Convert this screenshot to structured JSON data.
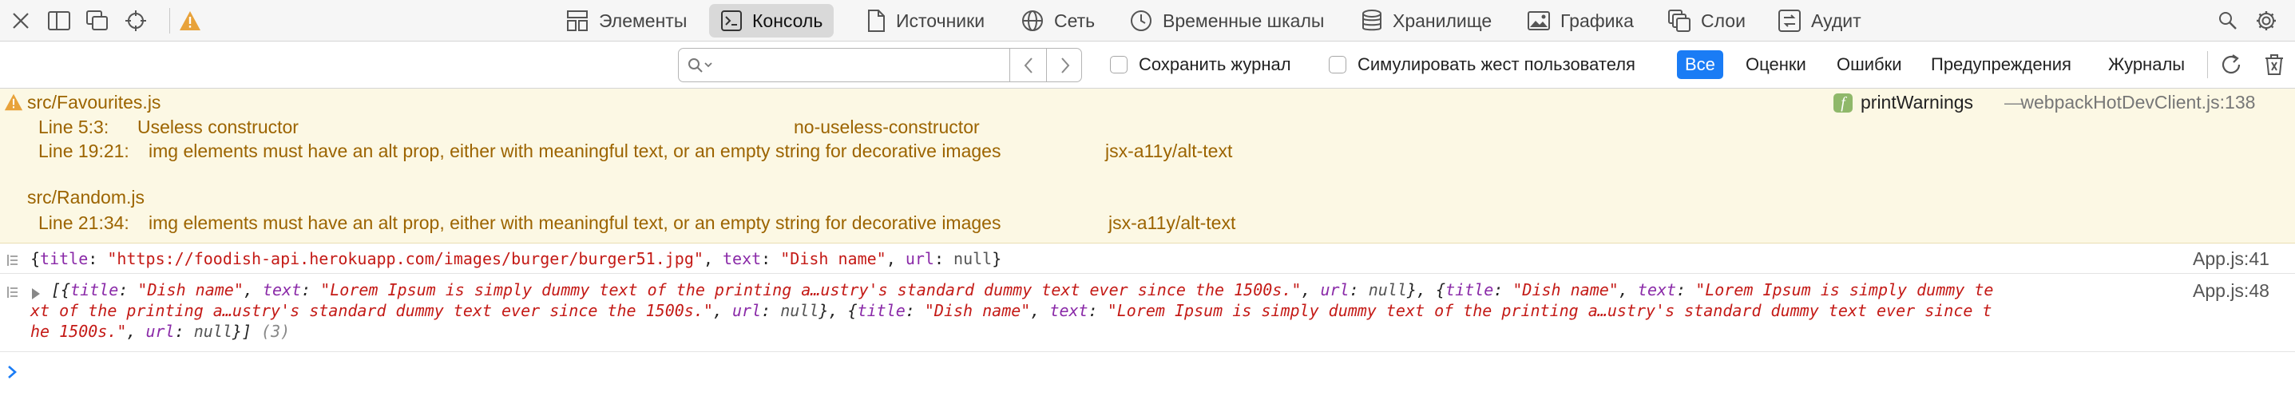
{
  "colors": {
    "accent": "#1a7cf5",
    "warning_text": "#9c6400",
    "warning_bg": "#fcf8e4",
    "key": "#8a2aa8",
    "string": "#c41a16"
  },
  "toolbar": {
    "left_icons": [
      "close-icon",
      "dock-side-icon",
      "undock-icon",
      "inspect-target-icon",
      "warning-icon"
    ],
    "tabs": [
      {
        "id": "elements",
        "label": "Элементы",
        "icon": "elements-icon"
      },
      {
        "id": "console",
        "label": "Консоль",
        "icon": "console-icon",
        "active": true
      },
      {
        "id": "sources",
        "label": "Источники",
        "icon": "document-icon"
      },
      {
        "id": "network",
        "label": "Сеть",
        "icon": "globe-icon"
      },
      {
        "id": "timelines",
        "label": "Временные шкалы",
        "icon": "clock-icon"
      },
      {
        "id": "storage",
        "label": "Хранилище",
        "icon": "database-icon"
      },
      {
        "id": "graphics",
        "label": "Графика",
        "icon": "image-icon"
      },
      {
        "id": "layers",
        "label": "Слои",
        "icon": "layers-icon"
      },
      {
        "id": "audit",
        "label": "Аудит",
        "icon": "audit-icon"
      }
    ],
    "right_icons": [
      "search-icon",
      "gear-icon"
    ]
  },
  "filter": {
    "search_value": "",
    "search_placeholder": "",
    "preserve_log_label": "Сохранить журнал",
    "simulate_gesture_label": "Симулировать жест пользователя",
    "levels": [
      {
        "label": "Все",
        "active": true
      },
      {
        "label": "Оценки"
      },
      {
        "label": "Ошибки"
      },
      {
        "label": "Предупреждения"
      },
      {
        "label": "Журналы"
      }
    ]
  },
  "console": {
    "warning": {
      "file1": "src/Favourites.js",
      "line1_loc": "Line 5:3:",
      "line1_msg": "Useless constructor",
      "line1_rule": "no-useless-constructor",
      "line2_loc": "Line 19:21:",
      "line2_msg": "img elements must have an alt prop, either with meaningful text, or an empty string for decorative images",
      "line2_rule": "jsx-a11y/alt-text",
      "file2": "src/Random.js",
      "line3_loc": "Line 21:34:",
      "line3_msg": "img elements must have an alt prop, either with meaningful text, or an empty string for decorative images",
      "line3_rule": "jsx-a11y/alt-text",
      "func": "printWarnings",
      "dash": "—",
      "source": "webpackHotDevClient.js:138"
    },
    "log1": {
      "source": "App.js:41",
      "k_title": "title",
      "v_title": "\"https://foodish-api.herokuapp.com/images/burger/burger51.jpg\"",
      "k_text": "text",
      "v_text": "\"Dish name\"",
      "k_url": "url",
      "v_url": "null"
    },
    "log2": {
      "source": "App.js:48",
      "k_title": "title",
      "v_title": "\"Dish name\"",
      "k_text": "text",
      "v_text_full": "\"Lorem Ipsum is simply dummy text of the printing a…ustry's standard dummy text ever since the 1500s.\"",
      "v_text_head": "\"Lorem Ipsum is simply dummy te",
      "v_text_mid": "xt of the printing a…ustry's standard dummy text ever since the 1500s.\"",
      "v_text_tail_a": "\"Lorem Ipsum is simply dummy text of the printing a…ustry's standard dummy text ever since t",
      "v_text_tail_b": "he 1500s.\"",
      "k_url": "url",
      "v_url": "null",
      "count": "(3)"
    }
  }
}
